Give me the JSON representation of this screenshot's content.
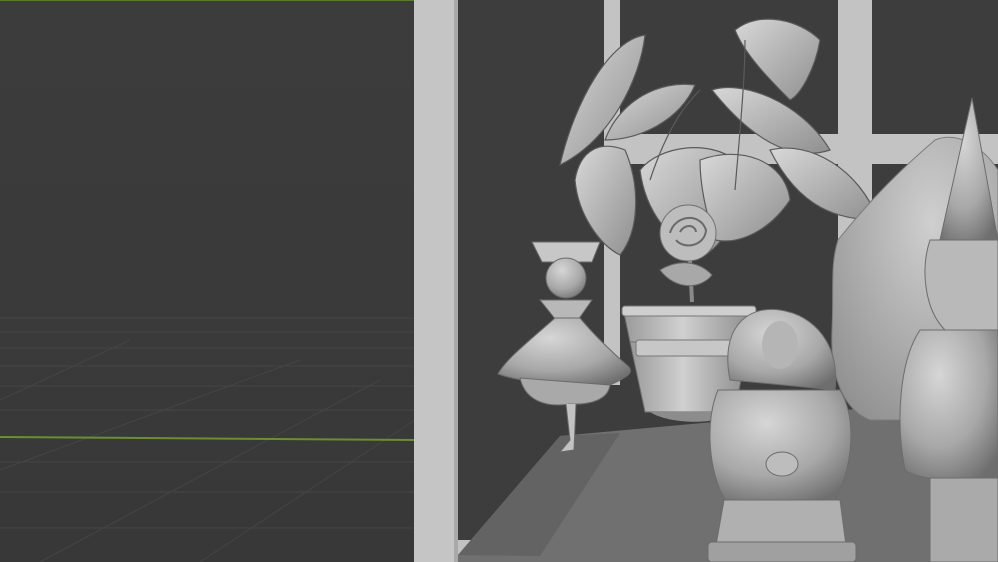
{
  "viewport": {
    "mode": "solid-shading",
    "colors": {
      "background": "#3d3d3d",
      "grid_line": "#4a4a4a",
      "x_axis": "#6b8f2e",
      "frame": "#c4c4c4",
      "window_glass": "#3f3f3f",
      "floor": "#6f6f6f",
      "model_light": "#c9c9c9",
      "model_mid": "#a9a9a9",
      "model_dark": "#7b7b7b"
    }
  }
}
